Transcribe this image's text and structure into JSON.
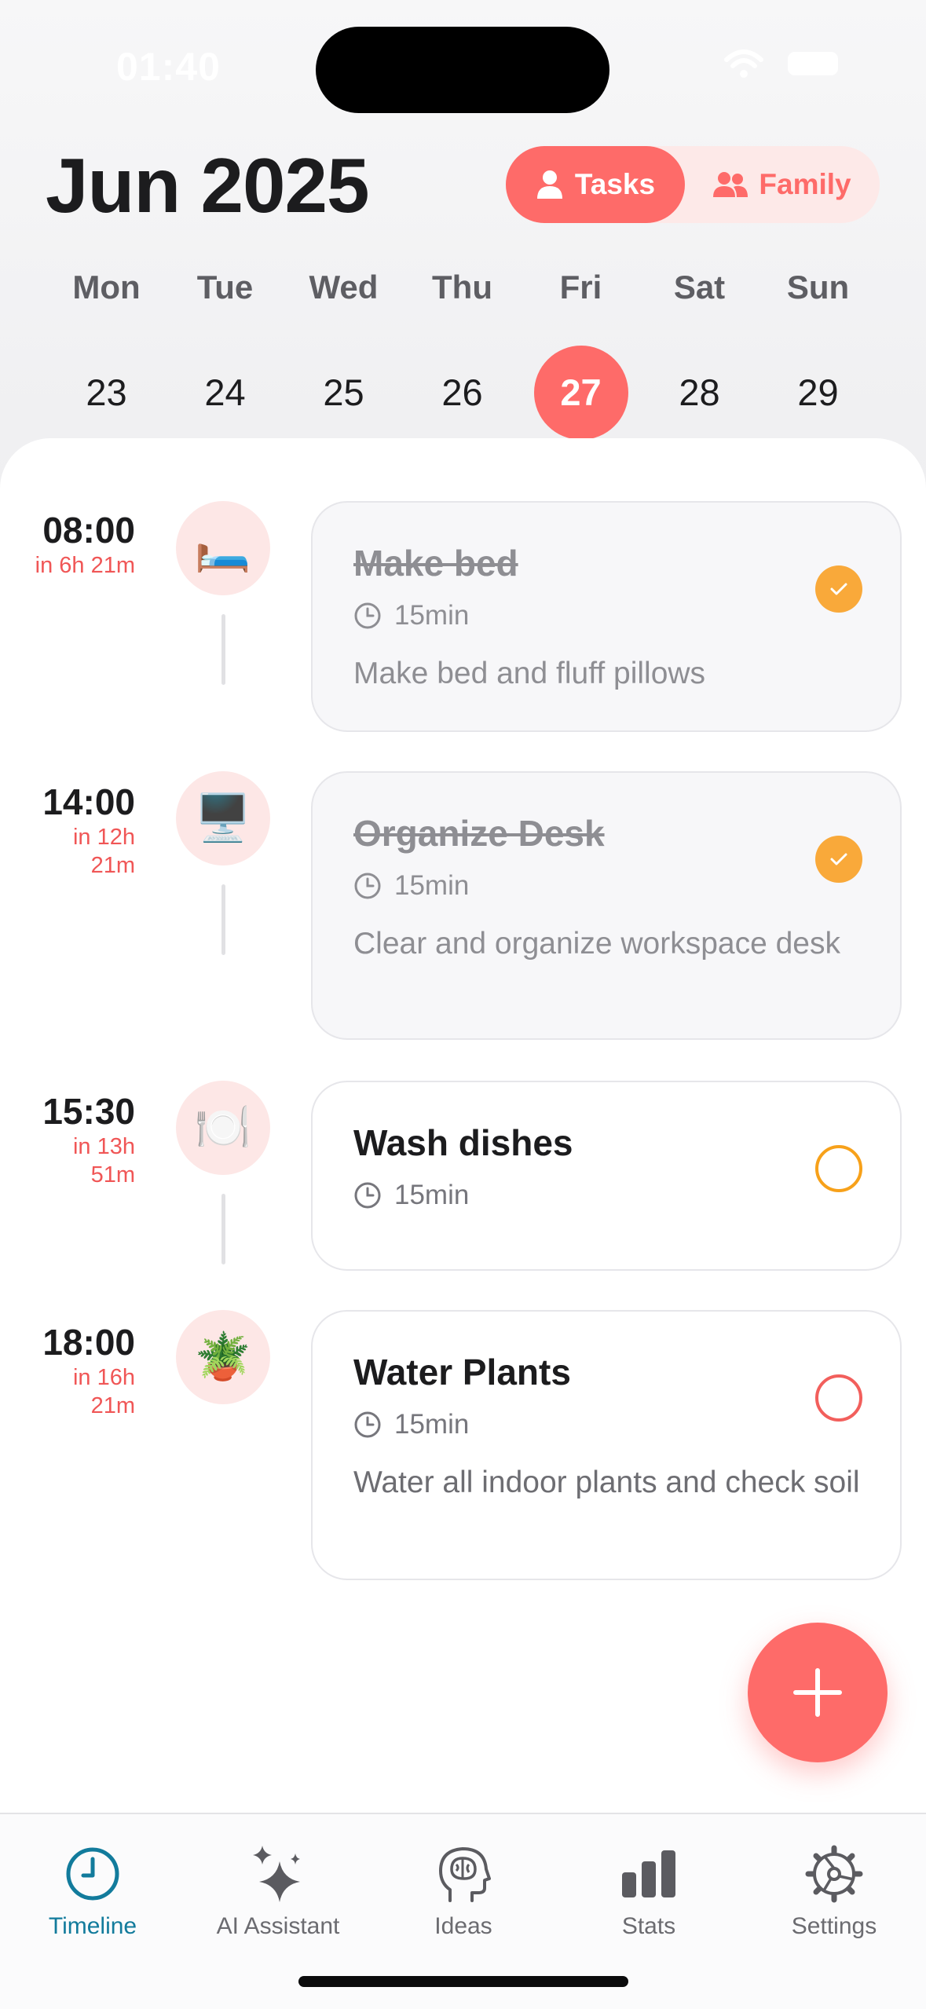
{
  "status_bar": {
    "time": "01:40"
  },
  "header": {
    "month_title": "Jun 2025",
    "segment": {
      "tasks_label": "Tasks",
      "family_label": "Family",
      "active": "Tasks"
    }
  },
  "week": {
    "days": [
      {
        "name": "Mon",
        "num": "23"
      },
      {
        "name": "Tue",
        "num": "24"
      },
      {
        "name": "Wed",
        "num": "25"
      },
      {
        "name": "Thu",
        "num": "26"
      },
      {
        "name": "Fri",
        "num": "27",
        "selected": true
      },
      {
        "name": "Sat",
        "num": "28"
      },
      {
        "name": "Sun",
        "num": "29"
      }
    ]
  },
  "tasks": [
    {
      "time": "08:00",
      "relative": "in 6h 21m",
      "emoji": "🛏️",
      "title": "Make bed",
      "duration": "15min",
      "description": "Make bed and fluff pillows",
      "done": true
    },
    {
      "time": "14:00",
      "relative": "in 12h 21m",
      "emoji": "🖥️",
      "title": "Organize Desk",
      "duration": "15min",
      "description": "Clear and organize workspace desk",
      "done": true
    },
    {
      "time": "15:30",
      "relative": "in 13h 51m",
      "emoji": "🍽️",
      "title": "Wash dishes",
      "duration": "15min",
      "description": "",
      "done": false
    },
    {
      "time": "18:00",
      "relative": "in 16h 21m",
      "emoji": "🪴",
      "title": "Water Plants",
      "duration": "15min",
      "description": "Water all indoor plants and check soil",
      "done": false
    }
  ],
  "tabbar": {
    "items": [
      {
        "label": "Timeline",
        "icon": "clock-icon",
        "active": true
      },
      {
        "label": "AI Assistant",
        "icon": "sparkles-icon"
      },
      {
        "label": "Ideas",
        "icon": "brain-head-icon"
      },
      {
        "label": "Stats",
        "icon": "bar-chart-icon"
      },
      {
        "label": "Settings",
        "icon": "gear-icon"
      }
    ]
  },
  "colors": {
    "accent": "#fe6b69",
    "check_done": "#f9a93a",
    "tab_active": "#127b9c"
  }
}
